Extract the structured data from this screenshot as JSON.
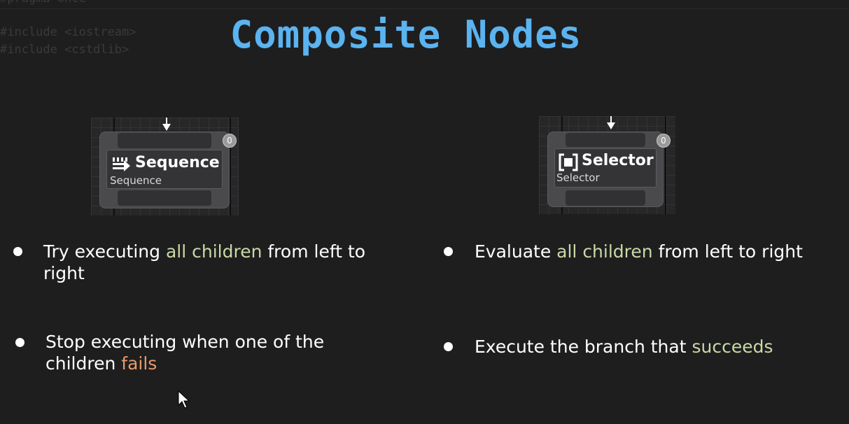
{
  "background_code": {
    "line_top": "#pragma once",
    "include1": "#include <iostream>",
    "include2": "#include <cstdlib>"
  },
  "title": "Composite Nodes",
  "sequence_node": {
    "title": "Sequence",
    "subtitle": "Sequence",
    "badge": "0",
    "icon": "sequence-arrows-icon"
  },
  "selector_node": {
    "title": "Selector",
    "subtitle": "Selector",
    "badge": "0",
    "icon": "selector-bracket-icon"
  },
  "sequence_bullets": [
    {
      "before": "Try executing ",
      "highlight": "all children",
      "after": " from left to",
      "line2": "right"
    },
    {
      "before": "Stop executing when one of the",
      "line2_before": "children ",
      "highlight": "fails"
    }
  ],
  "selector_bullets": [
    {
      "before": "Evaluate ",
      "highlight": "all children",
      "after": " from left to right"
    },
    {
      "before": "Execute the branch that ",
      "highlight": "succeeds"
    }
  ],
  "colors": {
    "title": "#5bb3f0",
    "highlight_green": "#c9d9a4",
    "highlight_orange": "#e89a6a",
    "background": "#1e1e1f"
  }
}
